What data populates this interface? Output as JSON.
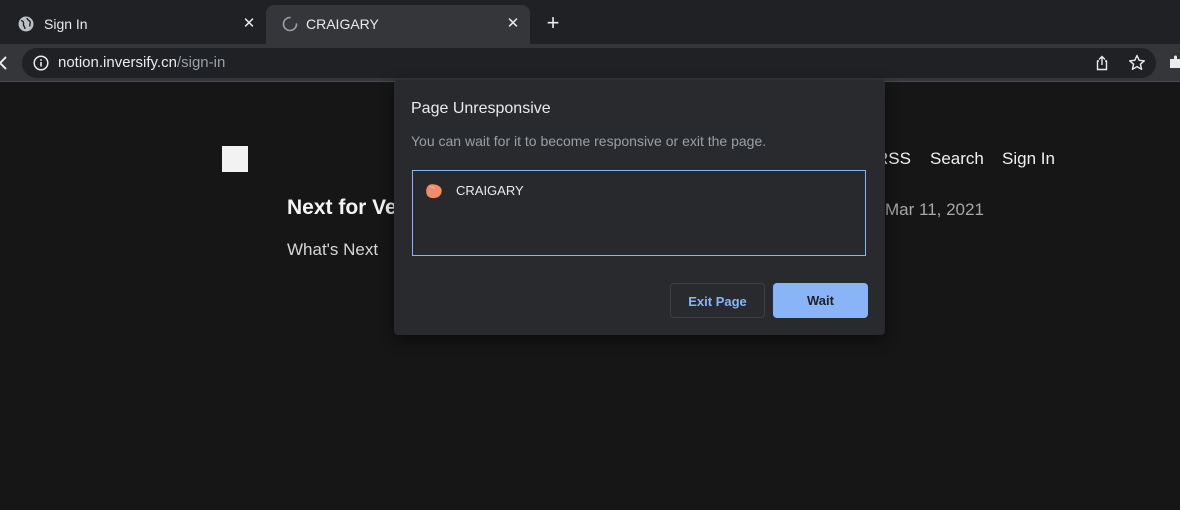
{
  "tabs": [
    {
      "title": "Sign In",
      "favicon": "globe-icon"
    },
    {
      "title": "CRAIGARY",
      "favicon": "loading-spinner-icon"
    }
  ],
  "new_tab_label": "+",
  "close_glyph": "✕",
  "address_bar": {
    "host": "notion.inversify.cn",
    "path": "/sign-in"
  },
  "site": {
    "nav": [
      "RSS",
      "Search",
      "Sign In"
    ],
    "post": {
      "title": "Next for Ve",
      "date": "Mar 11, 2021",
      "subtitle": "What's Next"
    }
  },
  "dialog": {
    "title": "Page Unresponsive",
    "message": "You can wait for it to become responsive or exit the page.",
    "pages": [
      {
        "label": "CRAIGARY",
        "favicon": "craigary-blob-icon"
      }
    ],
    "exit_label": "Exit Page",
    "wait_label": "Wait"
  },
  "colors": {
    "accent": "#8ab4f8",
    "favicon_orange": "#f28b6a"
  }
}
